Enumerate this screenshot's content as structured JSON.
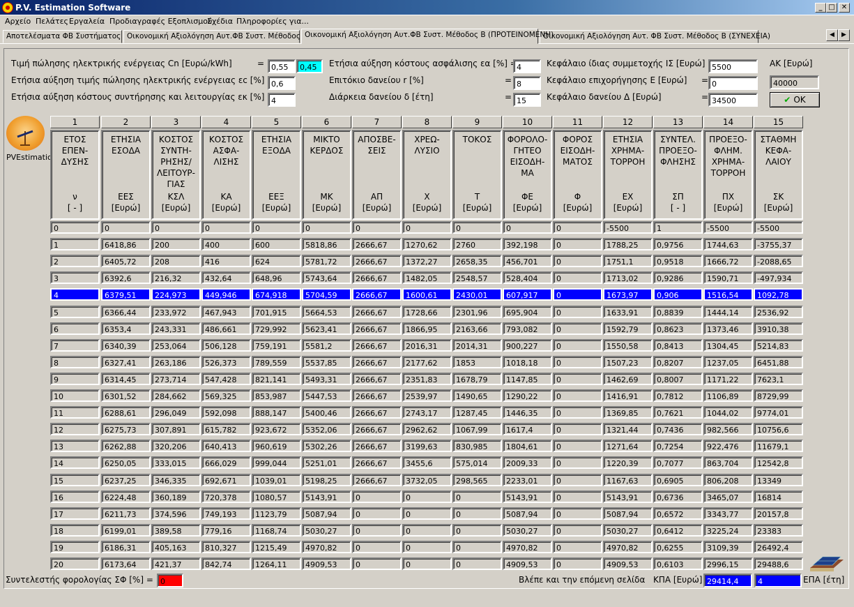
{
  "window": {
    "title": "P.V. Estimation Software",
    "buttons": [
      "_",
      "□",
      "✕"
    ]
  },
  "menu": [
    "Αρχείο",
    "Πελάτες",
    "Εργαλεία",
    "Προδιαγραφές Εξοπλισμού",
    "Σχέδια",
    "Πληροφορίες για..."
  ],
  "tabs": [
    "Αποτελέσματα ΦΒ Συστήματος",
    "Οικονομική Αξιολόγηση Αυτ.ΦΒ Συστ. Μέθοδος Α",
    "Οικονομική Αξιολόγηση Αυτ.ΦΒ Συστ. Μέθοδος Β (ΠΡΟΤΕΙΝΟΜΕΝΗ)",
    "Οικονομική Αξιολόγηση Αυτ. ΦΒ Συστ. Μέθοδος Β (ΣΥΝΕΧΕΙΑ)"
  ],
  "tab_scroll": [
    "◀",
    "▶"
  ],
  "params": {
    "cn_label": "Τιμή πώλησης ηλεκτρικής ενέργειας Cn [Ευρώ/kWh]",
    "cn_eq": "=",
    "cn_value": "0,55",
    "cn_value2": "0,45",
    "ec_label": "Ετήσια αύξηση τιμής πώλησης ηλεκτρικής ενέργειας εc [%] =",
    "ec_value": "0,6",
    "ek_label": "Ετήσια αύξηση κόστους συντήρησης και λειτουργίας εκ [%] =",
    "ek_value": "4",
    "ea_label": "Ετήσια αύξηση κόστους ασφάλισης εα [%] =",
    "ea_value": "4",
    "r_label": "Επιτόκιο δανείου r [%]",
    "r_eq": "=",
    "r_value": "8",
    "d_label": "Διάρκεια δανείου δ [έτη]",
    "d_eq": "=",
    "d_value": "15",
    "is_label": "Κεφάλαιο ίδιας συμμετοχής ΙΣ [Ευρώ] =",
    "is_value": "5500",
    "e_label": "Κεφάλαιο επιχορήγησης Ε [Ευρώ]",
    "e_eq": "=",
    "e_value": "0",
    "delta_label": "Κεφάλαιο δανείου Δ [Ευρώ]",
    "delta_eq": "=",
    "delta_value": "34500",
    "ak_label": "ΑΚ [Ευρώ]",
    "ak_value": "40000",
    "ok_label": "OK"
  },
  "logo_label": "PVEstimation",
  "columns": [
    {
      "num": "1",
      "name": "ΕΤΟΣ\nΕΠΕΝ-\nΔΥΣΗΣ",
      "sym": "ν",
      "unit": "[ - ]"
    },
    {
      "num": "2",
      "name": "ΕΤΗΣΙΑ\nΕΣΟΔΑ",
      "sym": "ΕΕΣ",
      "unit": "[Ευρώ]"
    },
    {
      "num": "3",
      "name": "ΚΟΣΤΟΣ\nΣΥΝΤΗ-\nΡΗΣΗΣ/\nΛΕΙΤΟΥΡ-\nΓΙΑΣ",
      "sym": "ΚΣΛ",
      "unit": "[Ευρώ]"
    },
    {
      "num": "4",
      "name": "ΚΟΣΤΟΣ\nΑΣΦΑ-\nΛΙΣΗΣ",
      "sym": "ΚΑ",
      "unit": "[Ευρώ]"
    },
    {
      "num": "5",
      "name": "ΕΤΗΣΙΑ\nΕΞΟΔΑ",
      "sym": "ΕΕΞ",
      "unit": "[Ευρώ]"
    },
    {
      "num": "6",
      "name": "ΜΙΚΤΟ\nΚΕΡΔΟΣ",
      "sym": "ΜΚ",
      "unit": "[Ευρώ]"
    },
    {
      "num": "7",
      "name": "ΑΠΟΣΒΕ-\nΣΕΙΣ",
      "sym": "ΑΠ",
      "unit": "[Ευρώ]"
    },
    {
      "num": "8",
      "name": "ΧΡΕΩ-\nΛΥΣΙΟ",
      "sym": "Χ",
      "unit": "[Ευρώ]"
    },
    {
      "num": "9",
      "name": "ΤΟΚΟΣ",
      "sym": "Τ",
      "unit": "[Ευρώ]"
    },
    {
      "num": "10",
      "name": "ΦΟΡΟΛΟ-\nΓΗΤΕΟ\nΕΙΣΟΔΗ-\nΜΑ",
      "sym": "ΦΕ",
      "unit": "[Ευρώ]"
    },
    {
      "num": "11",
      "name": "ΦΟΡΟΣ\nΕΙΣΟΔΗ-\nΜΑΤΟΣ",
      "sym": "Φ",
      "unit": "[Ευρώ]"
    },
    {
      "num": "12",
      "name": "ΕΤΗΣΙΑ\nΧΡΗΜΑ-\nΤΟΡΡΟΗ",
      "sym": "ΕΧ",
      "unit": "[Ευρώ]"
    },
    {
      "num": "13",
      "name": "ΣΥΝΤΕΛ.\nΠΡΟΕΞΟ-\nΦΛΗΣΗΣ",
      "sym": "ΣΠ",
      "unit": "[ - ]"
    },
    {
      "num": "14",
      "name": "ΠΡΟΕΞΟ-\nΦΛΗΜ.\nΧΡΗΜΑ-\nΤΟΡΡΟΗ",
      "sym": "ΠΧ",
      "unit": "[Ευρώ]"
    },
    {
      "num": "15",
      "name": "ΣΤΑΘΜΗ\nΚΕΦΑ-\nΛΑΙΟΥ",
      "sym": "ΣΚ",
      "unit": "[Ευρώ]"
    }
  ],
  "selected_row": 4,
  "rows": [
    [
      "0",
      "0",
      "0",
      "0",
      "0",
      "0",
      "0",
      "0",
      "0",
      "0",
      "0",
      "-5500",
      "1",
      "-5500",
      "-5500"
    ],
    [
      "1",
      "6418,86",
      "200",
      "400",
      "600",
      "5818,86",
      "2666,67",
      "1270,62",
      "2760",
      "392,198",
      "0",
      "1788,25",
      "0,9756",
      "1744,63",
      "-3755,37"
    ],
    [
      "2",
      "6405,72",
      "208",
      "416",
      "624",
      "5781,72",
      "2666,67",
      "1372,27",
      "2658,35",
      "456,701",
      "0",
      "1751,1",
      "0,9518",
      "1666,72",
      "-2088,65"
    ],
    [
      "3",
      "6392,6",
      "216,32",
      "432,64",
      "648,96",
      "5743,64",
      "2666,67",
      "1482,05",
      "2548,57",
      "528,404",
      "0",
      "1713,02",
      "0,9286",
      "1590,71",
      "-497,934"
    ],
    [
      "4",
      "6379,51",
      "224,973",
      "449,946",
      "674,918",
      "5704,59",
      "2666,67",
      "1600,61",
      "2430,01",
      "607,917",
      "0",
      "1673,97",
      "0,906",
      "1516,54",
      "1092,78"
    ],
    [
      "5",
      "6366,44",
      "233,972",
      "467,943",
      "701,915",
      "5664,53",
      "2666,67",
      "1728,66",
      "2301,96",
      "695,904",
      "0",
      "1633,91",
      "0,8839",
      "1444,14",
      "2536,92"
    ],
    [
      "6",
      "6353,4",
      "243,331",
      "486,661",
      "729,992",
      "5623,41",
      "2666,67",
      "1866,95",
      "2163,66",
      "793,082",
      "0",
      "1592,79",
      "0,8623",
      "1373,46",
      "3910,38"
    ],
    [
      "7",
      "6340,39",
      "253,064",
      "506,128",
      "759,191",
      "5581,2",
      "2666,67",
      "2016,31",
      "2014,31",
      "900,227",
      "0",
      "1550,58",
      "0,8413",
      "1304,45",
      "5214,83"
    ],
    [
      "8",
      "6327,41",
      "263,186",
      "526,373",
      "789,559",
      "5537,85",
      "2666,67",
      "2177,62",
      "1853",
      "1018,18",
      "0",
      "1507,23",
      "0,8207",
      "1237,05",
      "6451,88"
    ],
    [
      "9",
      "6314,45",
      "273,714",
      "547,428",
      "821,141",
      "5493,31",
      "2666,67",
      "2351,83",
      "1678,79",
      "1147,85",
      "0",
      "1462,69",
      "0,8007",
      "1171,22",
      "7623,1"
    ],
    [
      "10",
      "6301,52",
      "284,662",
      "569,325",
      "853,987",
      "5447,53",
      "2666,67",
      "2539,97",
      "1490,65",
      "1290,22",
      "0",
      "1416,91",
      "0,7812",
      "1106,89",
      "8729,99"
    ],
    [
      "11",
      "6288,61",
      "296,049",
      "592,098",
      "888,147",
      "5400,46",
      "2666,67",
      "2743,17",
      "1287,45",
      "1446,35",
      "0",
      "1369,85",
      "0,7621",
      "1044,02",
      "9774,01"
    ],
    [
      "12",
      "6275,73",
      "307,891",
      "615,782",
      "923,672",
      "5352,06",
      "2666,67",
      "2962,62",
      "1067,99",
      "1617,4",
      "0",
      "1321,44",
      "0,7436",
      "982,566",
      "10756,6"
    ],
    [
      "13",
      "6262,88",
      "320,206",
      "640,413",
      "960,619",
      "5302,26",
      "2666,67",
      "3199,63",
      "830,985",
      "1804,61",
      "0",
      "1271,64",
      "0,7254",
      "922,476",
      "11679,1"
    ],
    [
      "14",
      "6250,05",
      "333,015",
      "666,029",
      "999,044",
      "5251,01",
      "2666,67",
      "3455,6",
      "575,014",
      "2009,33",
      "0",
      "1220,39",
      "0,7077",
      "863,704",
      "12542,8"
    ],
    [
      "15",
      "6237,25",
      "346,335",
      "692,671",
      "1039,01",
      "5198,25",
      "2666,67",
      "3732,05",
      "298,565",
      "2233,01",
      "0",
      "1167,63",
      "0,6905",
      "806,208",
      "13349"
    ],
    [
      "16",
      "6224,48",
      "360,189",
      "720,378",
      "1080,57",
      "5143,91",
      "0",
      "0",
      "0",
      "5143,91",
      "0",
      "5143,91",
      "0,6736",
      "3465,07",
      "16814"
    ],
    [
      "17",
      "6211,73",
      "374,596",
      "749,193",
      "1123,79",
      "5087,94",
      "0",
      "0",
      "0",
      "5087,94",
      "0",
      "5087,94",
      "0,6572",
      "3343,77",
      "20157,8"
    ],
    [
      "18",
      "6199,01",
      "389,58",
      "779,16",
      "1168,74",
      "5030,27",
      "0",
      "0",
      "0",
      "5030,27",
      "0",
      "5030,27",
      "0,6412",
      "3225,24",
      "23383"
    ],
    [
      "19",
      "6186,31",
      "405,163",
      "810,327",
      "1215,49",
      "4970,82",
      "0",
      "0",
      "0",
      "4970,82",
      "0",
      "4970,82",
      "0,6255",
      "3109,39",
      "26492,4"
    ],
    [
      "20",
      "6173,64",
      "421,37",
      "842,74",
      "1264,11",
      "4909,53",
      "0",
      "0",
      "0",
      "4909,53",
      "0",
      "4909,53",
      "0,6103",
      "2996,15",
      "29488,6"
    ]
  ],
  "footer": {
    "tax_label": "Συντελεστής φορολογίας ΣΦ [%] =",
    "tax_value": "0",
    "next_page": "Βλέπε και την επόμενη σελίδα",
    "kpa_label": "ΚΠΑ [Ευρώ]",
    "kpa_value": "29414,4",
    "epa_value": "4",
    "epa_label": "ΕΠΑ [έτη]"
  },
  "colors": {
    "selection": "#0000ff",
    "cyan_field": "#00ffff",
    "red_field": "#ff0000",
    "title_start": "#0a246a"
  }
}
